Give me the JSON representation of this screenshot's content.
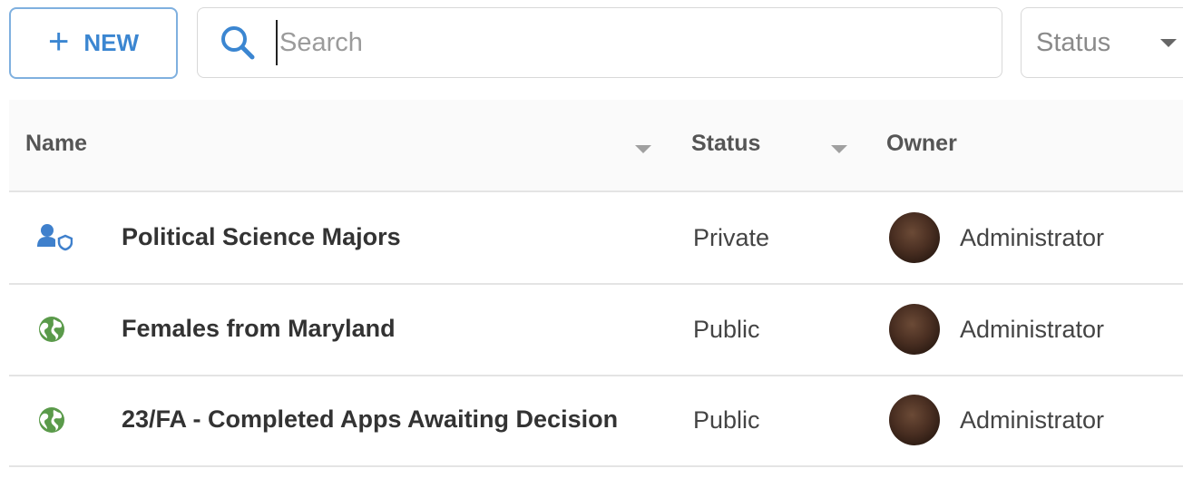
{
  "toolbar": {
    "new_label": "NEW",
    "search_placeholder": "Search",
    "search_value": "",
    "status_filter_label": "Status"
  },
  "table": {
    "columns": {
      "name": "Name",
      "status": "Status",
      "owner": "Owner"
    },
    "rows": [
      {
        "type_icon": "user-lock-icon",
        "name": "Political Science Majors",
        "status": "Private",
        "owner": "Administrator"
      },
      {
        "type_icon": "globe-icon",
        "name": "Females from Maryland",
        "status": "Public",
        "owner": "Administrator"
      },
      {
        "type_icon": "globe-icon",
        "name": "23/FA - Completed Apps Awaiting Decision",
        "status": "Public",
        "owner": "Administrator"
      }
    ]
  },
  "colors": {
    "accent": "#3b86d1",
    "accent_border": "#7fb0df",
    "globe_green": "#5a9a4a",
    "private_blue": "#3f80cc",
    "header_bg": "#fafafa",
    "divider": "#e4e4e4"
  }
}
